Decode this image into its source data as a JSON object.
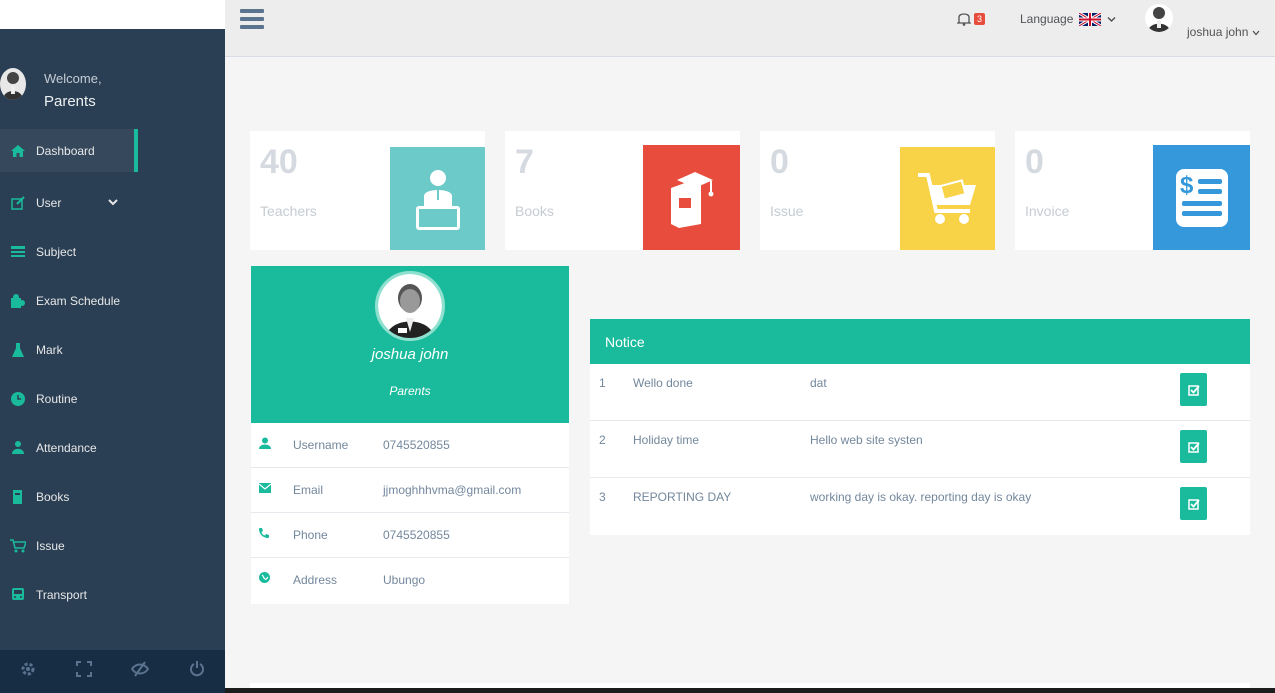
{
  "sidebar": {
    "welcome_label": "Welcome,",
    "welcome_role": "Parents",
    "items": [
      {
        "label": "Dashboard",
        "icon": "home-icon"
      },
      {
        "label": "User",
        "icon": "edit-icon"
      },
      {
        "label": "Subject",
        "icon": "list-icon"
      },
      {
        "label": "Exam Schedule",
        "icon": "puzzle-icon"
      },
      {
        "label": "Mark",
        "icon": "flask-icon"
      },
      {
        "label": "Routine",
        "icon": "clock-icon"
      },
      {
        "label": "Attendance",
        "icon": "users-icon"
      },
      {
        "label": "Books",
        "icon": "book-icon"
      },
      {
        "label": "Issue",
        "icon": "cart-icon"
      },
      {
        "label": "Transport",
        "icon": "bus-icon"
      }
    ]
  },
  "topbar": {
    "notification_count": "3",
    "language_label": "Language",
    "user_name": "joshua john"
  },
  "stats": [
    {
      "value": "40",
      "label": "Teachers",
      "color": "#6ccac9"
    },
    {
      "value": "7",
      "label": "Books",
      "color": "#e74c3c"
    },
    {
      "value": "0",
      "label": "Issue",
      "color": "#f8d347"
    },
    {
      "value": "0",
      "label": "Invoice",
      "color": "#3498db"
    }
  ],
  "profile": {
    "name": "joshua john",
    "role": "Parents",
    "rows": [
      {
        "key": "Username",
        "value": "0745520855"
      },
      {
        "key": "Email",
        "value": "jjmoghhhvma@gmail.com"
      },
      {
        "key": "Phone",
        "value": "0745520855"
      },
      {
        "key": "Address",
        "value": "Ubungo"
      }
    ]
  },
  "notice": {
    "title": "Notice",
    "rows": [
      {
        "no": "1",
        "title": "Wello done",
        "text": "dat"
      },
      {
        "no": "2",
        "title": "Holiday time",
        "text": "Hello web site systen"
      },
      {
        "no": "3",
        "title": "REPORTING DAY",
        "text": "working day is okay. reporting day is okay"
      }
    ]
  },
  "colors": {
    "accent": "#1abb9c",
    "sidebar": "#2a3f54"
  }
}
